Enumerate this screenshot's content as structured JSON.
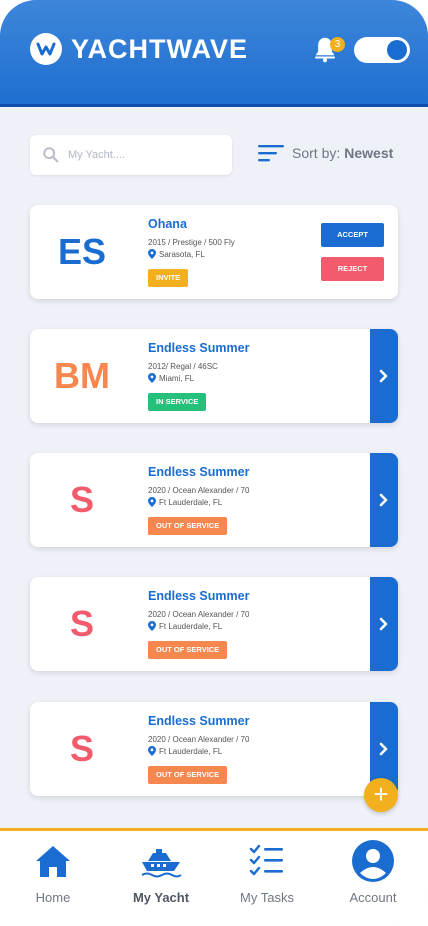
{
  "app": {
    "brand": "YACHTWAVE",
    "notification_count": "3"
  },
  "search": {
    "placeholder": "My Yacht...."
  },
  "sort": {
    "label": "Sort by:",
    "value": "Newest"
  },
  "yachts": [
    {
      "initials": "ES",
      "name": "Ohana",
      "detail": "2015 / Prestige / 500 Fly",
      "location": "Sarasota, FL",
      "status": "INVITE",
      "accept_label": "ACCEPT",
      "reject_label": "REJECT"
    },
    {
      "initials": "BM",
      "name": "Endless Summer",
      "detail": "2012/ Regal / 46SC",
      "location": "Miami, FL",
      "status": "IN SERVICE"
    },
    {
      "initials": "S",
      "name": "Endless Summer",
      "detail": "2020 / Ocean Alexander / 70",
      "location": "Ft Lauderdale, FL",
      "status": "OUT OF SERVICE"
    },
    {
      "initials": "S",
      "name": "Endless Summer",
      "detail": "2020 / Ocean Alexander / 70",
      "location": "Ft Lauderdale, FL",
      "status": "OUT OF SERVICE"
    },
    {
      "initials": "S",
      "name": "Endless Summer",
      "detail": "2020 / Ocean Alexander / 70",
      "location": "Ft Lauderdale, FL",
      "status": "OUT OF SERVICE"
    }
  ],
  "tabs": [
    {
      "label": "Home",
      "icon": "home-icon"
    },
    {
      "label": "My Yacht",
      "icon": "yacht-icon",
      "active": true
    },
    {
      "label": "My Tasks",
      "icon": "tasks-icon"
    },
    {
      "label": "Account",
      "icon": "account-icon"
    }
  ],
  "colors": {
    "primary": "#1a6cd0",
    "accent": "#f2b01e",
    "invite": "#f2b01e",
    "in_service": "#27c07a",
    "out_of_service": "#f5874f",
    "reject": "#f25b6b",
    "initials_blue": "#1a6cd0",
    "initials_orange": "#f5874f",
    "initials_red": "#f25b6b"
  }
}
